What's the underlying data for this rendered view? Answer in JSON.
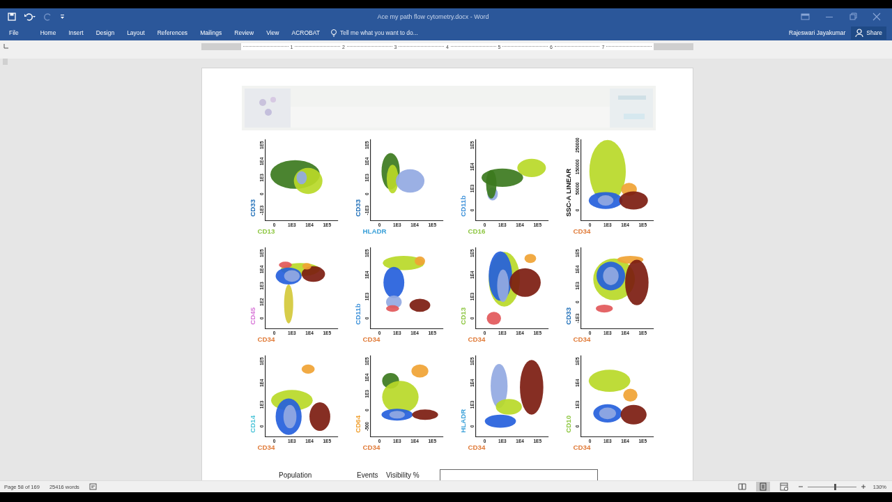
{
  "window": {
    "title": "Ace my path flow cytometry.docx - Word"
  },
  "ribbon": {
    "tabs": [
      {
        "label": "File",
        "selected": false
      },
      {
        "label": "Home",
        "selected": false
      },
      {
        "label": "Insert",
        "selected": false
      },
      {
        "label": "Design",
        "selected": false
      },
      {
        "label": "Layout",
        "selected": false
      },
      {
        "label": "References",
        "selected": false
      },
      {
        "label": "Mailings",
        "selected": false
      },
      {
        "label": "Review",
        "selected": false
      },
      {
        "label": "View",
        "selected": false
      },
      {
        "label": "ACROBAT",
        "selected": false
      }
    ],
    "tell_me": {
      "placeholder": "Tell me what you want to do..."
    },
    "user": "Rajeswari Jayakumar",
    "share": "Share"
  },
  "ruler": {
    "numbers": [
      "1",
      "2",
      "3",
      "4",
      "5",
      "6",
      "7"
    ]
  },
  "document": {
    "figure": {
      "plots": [
        {
          "ylabel": {
            "text": "CD33",
            "color": "#1f6fb8"
          },
          "xlabel": {
            "text": "CD13",
            "color": "#8cc63f"
          },
          "yticks": [
            "1E5",
            "1E4",
            "1E3",
            "0",
            "-1E3"
          ],
          "xticks": [
            "0",
            "1E3",
            "1E4",
            "1E5"
          ]
        },
        {
          "ylabel": {
            "text": "CD33",
            "color": "#1f6fb8"
          },
          "xlabel": {
            "text": "HLADR",
            "color": "#3aa0d8"
          },
          "yticks": [
            "1E5",
            "1E4",
            "1E3",
            "0",
            "-1E3"
          ],
          "xticks": [
            "0",
            "1E3",
            "1E4",
            "1E5"
          ]
        },
        {
          "ylabel": {
            "text": "CD11b",
            "color": "#3a8fd8"
          },
          "xlabel": {
            "text": "CD16",
            "color": "#8cc63f"
          },
          "yticks": [
            "1E5",
            "1E4",
            "1E3",
            "0"
          ],
          "xticks": [
            "0",
            "1E3",
            "1E4",
            "1E5"
          ]
        },
        {
          "ylabel": {
            "text": "SSC-A LINEAR",
            "color": "#111111"
          },
          "xlabel": {
            "text": "CD34",
            "color": "#e07b39"
          },
          "yticks": [
            "250000",
            "150000",
            "50000",
            "0"
          ],
          "xticks": [
            "0",
            "1E3",
            "1E4",
            "1E5"
          ]
        },
        {
          "ylabel": {
            "text": "CD45",
            "color": "#d878d8"
          },
          "xlabel": {
            "text": "CD34",
            "color": "#e07b39"
          },
          "yticks": [
            "1E5",
            "1E4",
            "1E3",
            "1E2",
            "0"
          ],
          "xticks": [
            "0",
            "1E3",
            "1E4",
            "1E5"
          ]
        },
        {
          "ylabel": {
            "text": "CD11b",
            "color": "#3a8fd8"
          },
          "xlabel": {
            "text": "CD34",
            "color": "#e07b39"
          },
          "yticks": [
            "1E5",
            "1E4",
            "1E3",
            "0"
          ],
          "xticks": [
            "0",
            "1E3",
            "1E4",
            "1E5"
          ]
        },
        {
          "ylabel": {
            "text": "CD13",
            "color": "#8cc63f"
          },
          "xlabel": {
            "text": "CD34",
            "color": "#e07b39"
          },
          "yticks": [
            "1E5",
            "1E4",
            "1E3",
            "0"
          ],
          "xticks": [
            "0",
            "1E3",
            "1E4",
            "1E5"
          ]
        },
        {
          "ylabel": {
            "text": "CD33",
            "color": "#1f6fb8"
          },
          "xlabel": {
            "text": "CD34",
            "color": "#e07b39"
          },
          "yticks": [
            "1E5",
            "1E4",
            "1E3",
            "0",
            "-1E3"
          ],
          "xticks": [
            "0",
            "1E3",
            "1E4",
            "1E5"
          ]
        },
        {
          "ylabel": {
            "text": "CD14",
            "color": "#4cc4d8"
          },
          "xlabel": {
            "text": "CD34",
            "color": "#e07b39"
          },
          "yticks": [
            "1E5",
            "1E4",
            "1E3",
            "0"
          ],
          "xticks": [
            "0",
            "1E3",
            "1E4",
            "1E5"
          ]
        },
        {
          "ylabel": {
            "text": "CD64",
            "color": "#f0a030"
          },
          "xlabel": {
            "text": "CD34",
            "color": "#e07b39"
          },
          "yticks": [
            "1E5",
            "1E4",
            "1E3",
            "0",
            "-500"
          ],
          "xticks": [
            "0",
            "1E3",
            "1E4",
            "1E5"
          ]
        },
        {
          "ylabel": {
            "text": "HLADR",
            "color": "#3aa0d8"
          },
          "xlabel": {
            "text": "CD34",
            "color": "#e07b39"
          },
          "yticks": [
            "1E5",
            "1E4",
            "1E3",
            "0"
          ],
          "xticks": [
            "0",
            "1E3",
            "1E4",
            "1E5"
          ]
        },
        {
          "ylabel": {
            "text": "CD10",
            "color": "#8cc63f"
          },
          "xlabel": {
            "text": "CD34",
            "color": "#e07b39"
          },
          "yticks": [
            "1E5",
            "1E4",
            "1E3",
            "0"
          ],
          "xticks": [
            "0",
            "1E3",
            "1E4",
            "1E5"
          ]
        }
      ]
    },
    "table_header": [
      "Population",
      "Events",
      "Visibility %"
    ]
  },
  "status_bar": {
    "page": "Page 58 of 169",
    "words": "25416 words",
    "zoom": "130%",
    "zoom_slider": {
      "level": 0.55
    }
  }
}
